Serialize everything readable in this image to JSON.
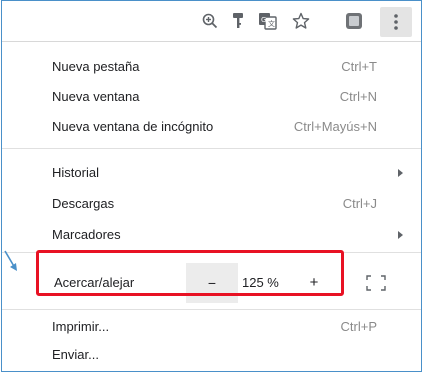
{
  "toolbar": {
    "icons": [
      "zoom-icon",
      "key-icon",
      "translate-icon",
      "star-icon",
      "extension-icon",
      "menu-icon"
    ]
  },
  "menu": {
    "items_group1": [
      {
        "label": "Nueva pestaña",
        "shortcut": "Ctrl+T"
      },
      {
        "label": "Nueva ventana",
        "shortcut": "Ctrl+N"
      },
      {
        "label": "Nueva ventana de incógnito",
        "shortcut": "Ctrl+Mayús+N"
      }
    ],
    "items_group2": [
      {
        "label": "Historial",
        "shortcut": ""
      },
      {
        "label": "Descargas",
        "shortcut": "Ctrl+J"
      },
      {
        "label": "Marcadores",
        "shortcut": ""
      }
    ],
    "zoom": {
      "label": "Acercar/alejar",
      "minus": "−",
      "value": "125 %",
      "plus": "+"
    },
    "items_group3": [
      {
        "label": "Imprimir...",
        "shortcut": "Ctrl+P"
      },
      {
        "label": "Enviar...",
        "shortcut": ""
      }
    ]
  },
  "colors": {
    "highlight": "#e81123",
    "frame_border": "#4a90c9"
  }
}
